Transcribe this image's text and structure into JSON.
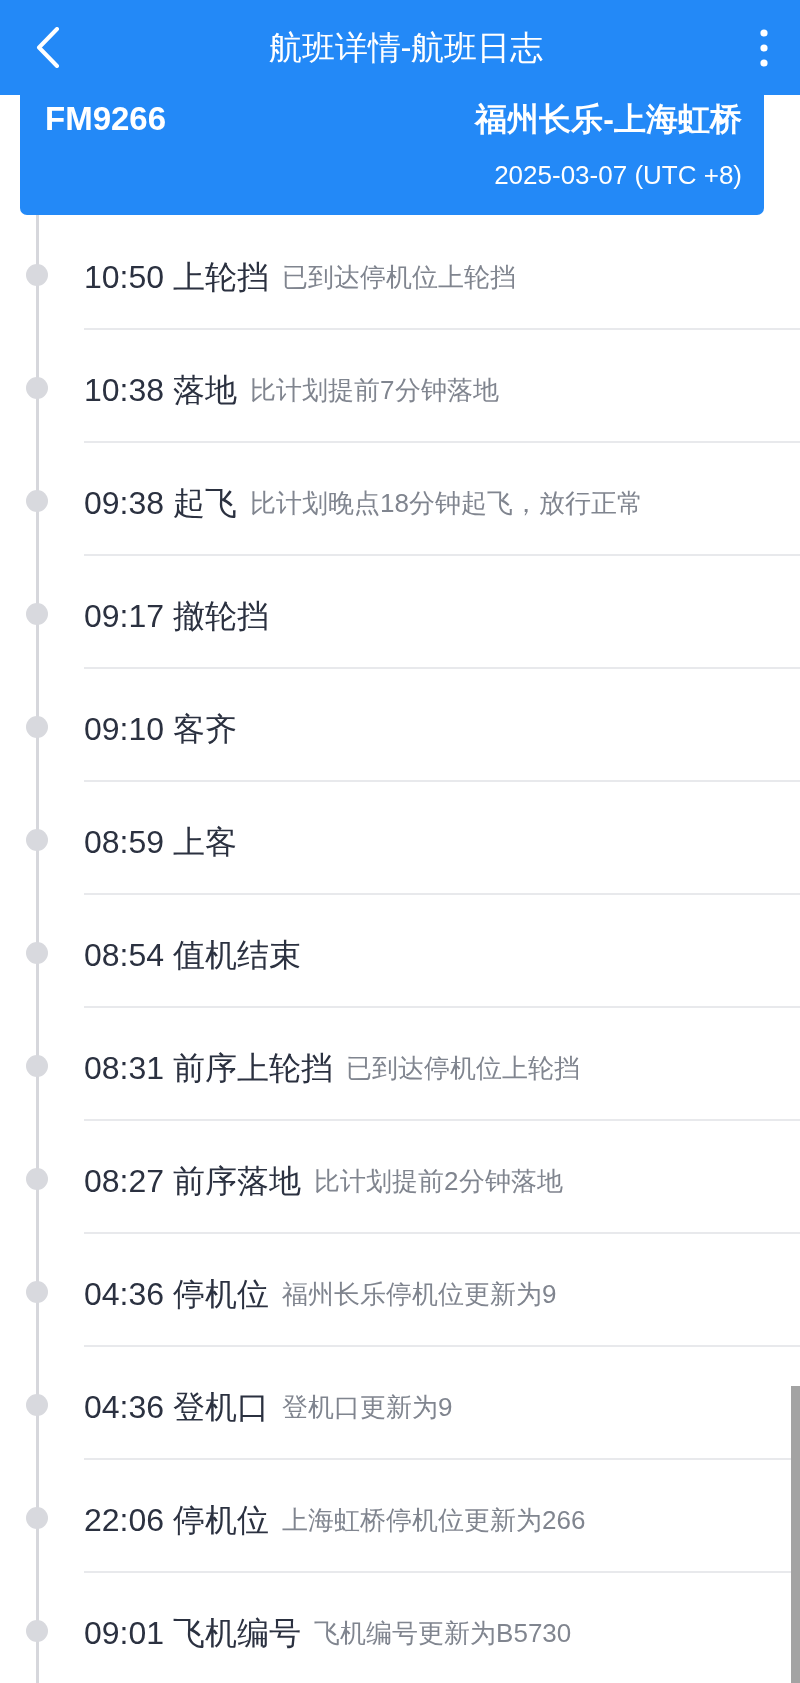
{
  "header": {
    "title": "航班详情-航班日志"
  },
  "flight": {
    "number": "FM9266",
    "route": "福州长乐-上海虹桥",
    "date": "2025-03-07 (UTC +8)"
  },
  "log": [
    {
      "time": "10:50",
      "event": "上轮挡",
      "detail": "已到达停机位上轮挡"
    },
    {
      "time": "10:38",
      "event": "落地",
      "detail": "比计划提前7分钟落地"
    },
    {
      "time": "09:38",
      "event": "起飞",
      "detail": "比计划晚点18分钟起飞，放行正常"
    },
    {
      "time": "09:17",
      "event": "撤轮挡"
    },
    {
      "time": "09:10",
      "event": "客齐"
    },
    {
      "time": "08:59",
      "event": "上客"
    },
    {
      "time": "08:54",
      "event": "值机结束"
    },
    {
      "time": "08:31",
      "event": "前序上轮挡",
      "detail": "已到达停机位上轮挡"
    },
    {
      "time": "08:27",
      "event": "前序落地",
      "detail": "比计划提前2分钟落地"
    },
    {
      "time": "04:36",
      "event": "停机位",
      "detail": "福州长乐停机位更新为9"
    },
    {
      "time": "04:36",
      "event": "登机口",
      "detail": "登机口更新为9"
    },
    {
      "time": "22:06",
      "event": "停机位",
      "detail": "上海虹桥停机位更新为266"
    },
    {
      "time": "09:01",
      "event": "飞机编号",
      "detail": "飞机编号更新为B5730"
    }
  ]
}
